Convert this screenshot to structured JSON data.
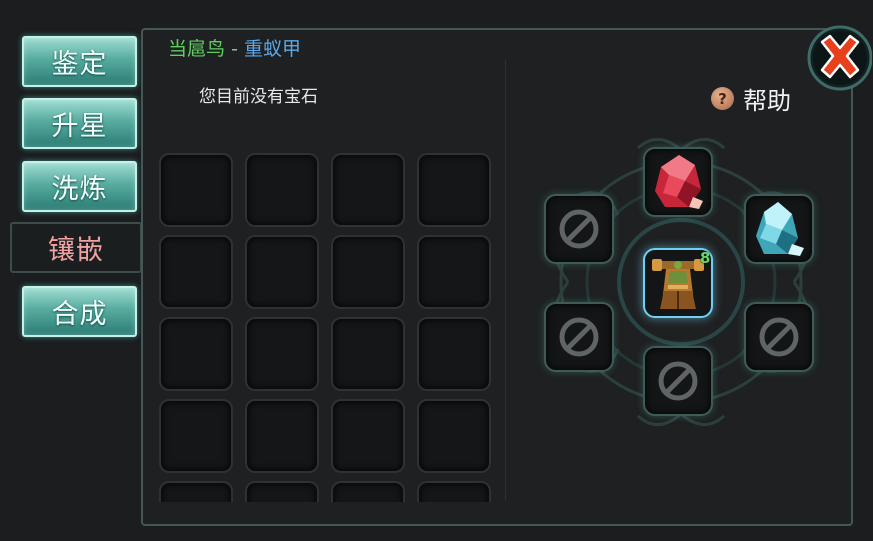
{
  "tabs": [
    {
      "label": "鉴定",
      "active": false
    },
    {
      "label": "升星",
      "active": false
    },
    {
      "label": "洗炼",
      "active": false
    },
    {
      "label": "镶嵌",
      "active": true
    },
    {
      "label": "合成",
      "active": false
    }
  ],
  "header": {
    "pet_name": "当扈鸟",
    "separator": "-",
    "item_name": "重蚁甲"
  },
  "inventory": {
    "empty_message": "您目前没有宝石"
  },
  "help": {
    "icon": "question-icon",
    "glyph": "?",
    "label": "帮助"
  },
  "equipment": {
    "level_text": "8",
    "slots": [
      {
        "position": "top",
        "state": "ruby-gem"
      },
      {
        "position": "upper-left",
        "state": "locked"
      },
      {
        "position": "upper-right",
        "state": "aquamarine-gem"
      },
      {
        "position": "lower-left",
        "state": "locked"
      },
      {
        "position": "lower-right",
        "state": "locked"
      },
      {
        "position": "bottom",
        "state": "locked"
      }
    ]
  },
  "colors": {
    "pet_name": "#5fcf5f",
    "item_name": "#5aa8ea",
    "active_tab": "#f0a2a2",
    "tab_bg": "#57ab9f",
    "close_x": "#e8401d"
  }
}
